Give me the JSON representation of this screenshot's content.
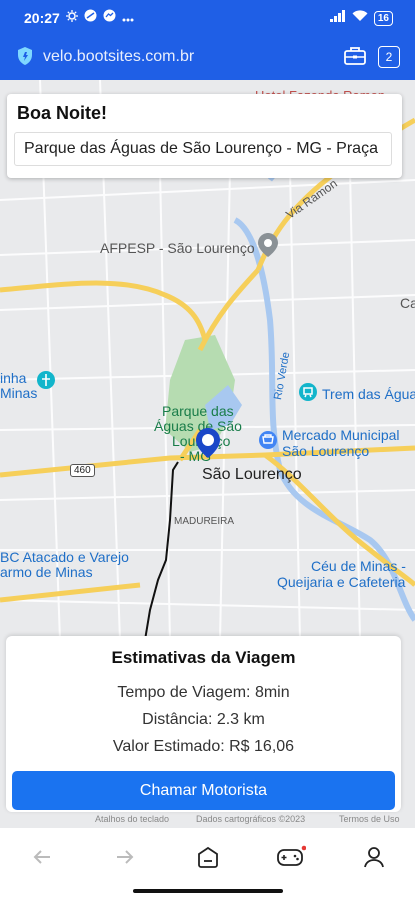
{
  "status_bar": {
    "time": "20:27",
    "battery": "16"
  },
  "browser": {
    "url": "velo.bootsites.com.br",
    "tab_count": "2"
  },
  "greeting": {
    "title": "Boa Noite!",
    "destination_value": "Parque das Águas de São Lourenço - MG - Praça"
  },
  "map": {
    "labels": {
      "hotel": "Hotel Fazenda Ramon",
      "via_ramon": "Via Ramon",
      "afpesp": "AFPESP - São Lourenço",
      "ca": "Ca",
      "rio_verde": "Rio Verde",
      "trem": "Trem das Águas",
      "mercado_1": "Mercado Municipal",
      "mercado_2": "São Lourenço",
      "inha_1": "inha",
      "inha_2": "Minas",
      "parque_1": "Parque das",
      "parque_2": "Águas de São",
      "parque_3": "Lourenço",
      "parque_4": "- MG",
      "city": "São Lourenço",
      "road": "460",
      "madureira": "MADUREIRA",
      "atacado_1": "BC Atacado e Varejo",
      "atacado_2": "armo de Minas",
      "ceu_1": "Céu de Minas -",
      "ceu_2": "Queijaria e Cafeteria"
    },
    "attribution": {
      "keyboard": "Atalhos do teclado",
      "data": "Dados cartográficos ©2023",
      "terms": "Termos de Uso"
    }
  },
  "estimates": {
    "title": "Estimativas da Viagem",
    "time_line": "Tempo de Viagem: 8min",
    "distance_line": "Distância: 2.3 km",
    "price_line": "Valor Estimado: R$ 16,06",
    "button": "Chamar Motorista"
  },
  "colors": {
    "brand": "#1f5fe6",
    "button": "#1a73f0",
    "map_road": "#f6cf5a"
  }
}
